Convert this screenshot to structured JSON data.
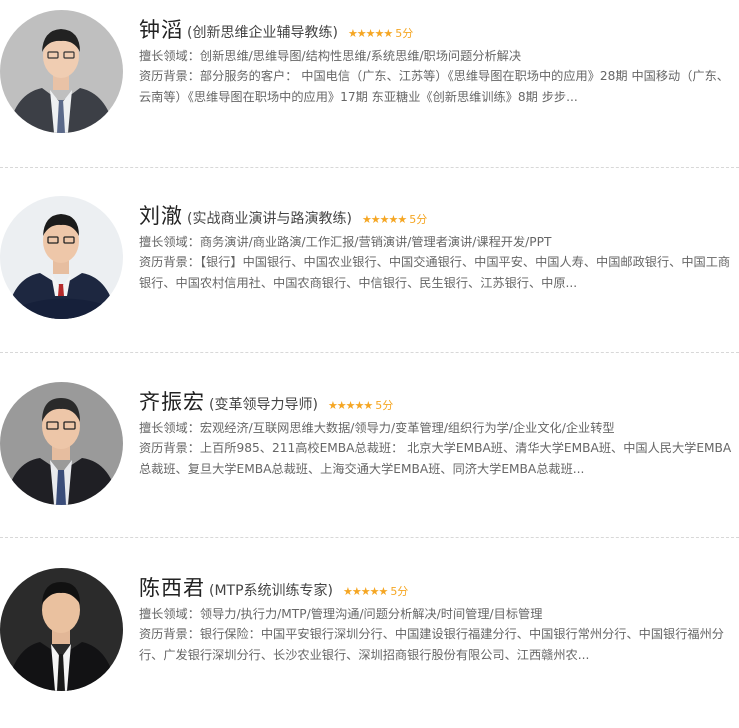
{
  "colors": {
    "star": "#f5a623",
    "name": "#222222",
    "text": "#666666",
    "divider": "#d8d8d8"
  },
  "icons": {
    "star": "star-icon"
  },
  "experts": [
    {
      "name": "钟滔",
      "role": "(创新思维企业辅导教练)",
      "stars": "★★★★★",
      "score": "5分",
      "specialty": "擅长领域：创新思维/思维导图/结构性思维/系统思维/职场问题分析解决",
      "background": "资历背景：部分服务的客户： 中国电信（广东、江苏等）《思维导图在职场中的应用》28期 中国移动（广东、云南等）《思维导图在职场中的应用》17期 东亚糖业《创新思维训练》8期 步步..."
    },
    {
      "name": "刘澈",
      "role": "(实战商业演讲与路演教练)",
      "stars": "★★★★★",
      "score": "5分",
      "specialty": "擅长领域：商务演讲/商业路演/工作汇报/营销演讲/管理者演讲/课程开发/PPT",
      "background": "资历背景：【银行】中国银行、中国农业银行、中国交通银行、中国平安、中国人寿、中国邮政银行、中国工商银行、中国农村信用社、中国农商银行、中信银行、民生银行、江苏银行、中原..."
    },
    {
      "name": "齐振宏",
      "role": "(变革领导力导师)",
      "stars": "★★★★★",
      "score": "5分",
      "specialty": "擅长领域：宏观经济/互联网思维大数据/领导力/变革管理/组织行为学/企业文化/企业转型",
      "background": "资历背景：上百所985、211高校EMBA总裁班： 北京大学EMBA班、清华大学EMBA班、中国人民大学EMBA总裁班、复旦大学EMBA总裁班、上海交通大学EMBA班、同济大学EMBA总裁班..."
    },
    {
      "name": "陈西君",
      "role": "(MTP系统训练专家)",
      "stars": "★★★★★",
      "score": "5分",
      "specialty": "擅长领域：领导力/执行力/MTP/管理沟通/问题分析解决/时间管理/目标管理",
      "background": "资历背景：银行保险：中国平安银行深圳分行、中国建设银行福建分行、中国银行常州分行、中国银行福州分行、广发银行深圳分行、长沙农业银行、深圳招商银行股份有限公司、江西赣州农..."
    }
  ]
}
